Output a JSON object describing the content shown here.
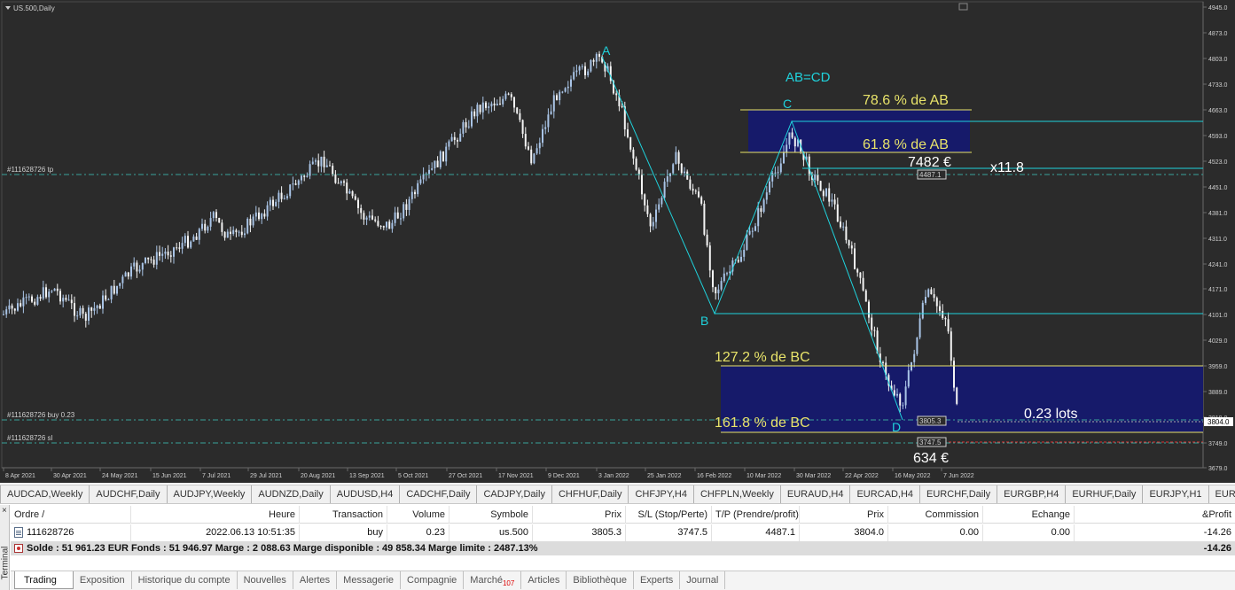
{
  "chart": {
    "symbol_label": "US.500,Daily",
    "colors": {
      "background": "#2b2b2b",
      "bull": "#a9c4e6",
      "bear": "#f4f4f4",
      "zigzag": "#1fd3dd",
      "gold": "#e8e36a",
      "box": "#161a6a",
      "text_white": "#ffffff",
      "price_tag": "#cfcfcf",
      "tp_line": "#3aa39b",
      "sl_line": "#d33"
    },
    "price_axis": [
      "4945.0",
      "4873.0",
      "4803.0",
      "4733.0",
      "4663.0",
      "4593.0",
      "4523.0",
      "4451.0",
      "4381.0",
      "4311.0",
      "4241.0",
      "4171.0",
      "4101.0",
      "4029.0",
      "3959.0",
      "3889.0",
      "3819.0",
      "3804.0",
      "3749.0",
      "3679.0"
    ],
    "time_axis": [
      "8 Apr 2021",
      "30 Apr 2021",
      "24 May 2021",
      "15 Jun 2021",
      "7 Jul 2021",
      "29 Jul 2021",
      "20 Aug 2021",
      "13 Sep 2021",
      "5 Oct 2021",
      "27 Oct 2021",
      "17 Nov 2021",
      "9 Dec 2021",
      "3 Jan 2022",
      "25 Jan 2022",
      "16 Feb 2022",
      "10 Mar 2022",
      "30 Mar 2022",
      "22 Apr 2022",
      "16 May 2022",
      "7 Jun 2022"
    ],
    "points": {
      "a": "A",
      "b": "B",
      "c": "C",
      "d": "D"
    },
    "texts": {
      "ab_cd": "AB=CD",
      "fib_786": "78.6 % de AB",
      "fib_618": "61.8 % de AB",
      "fib_1272": "127.2 % de BC",
      "fib_1618": "161.8 % de BC",
      "tp_money": "7482 €",
      "ratio": "x11.8",
      "lots": "0.23 lots",
      "sl_money": "634 €",
      "tp_label": "#111628726 tp",
      "buy_label": "#111628726 buy 0.23",
      "sl_label": "#111628726 sl",
      "tp_tag": "4487.1",
      "buy_tag": "3805.3",
      "sl_tag": "3747.5",
      "current_price": "3804.0"
    }
  },
  "symbol_tabs": [
    "AUDCAD,Weekly",
    "AUDCHF,Daily",
    "AUDJPY,Weekly",
    "AUDNZD,Daily",
    "AUDUSD,H4",
    "CADCHF,Daily",
    "CADJPY,Daily",
    "CHFHUF,Daily",
    "CHFJPY,H4",
    "CHFPLN,Weekly",
    "EURAUD,H4",
    "EURCAD,H4",
    "EURCHF,Daily",
    "EURGBP,H4",
    "EURHUF,Daily",
    "EURJPY,H1",
    "EURNO"
  ],
  "terminal": {
    "side_label": "Terminal",
    "close_glyph": "×",
    "columns": [
      "Ordre",
      "/",
      "Heure",
      "Transaction",
      "Volume",
      "Symbole",
      "Prix",
      "S/L (Stop/Perte)",
      "T/P (Prendre/profit)",
      "Prix",
      "Commission",
      "Echange",
      "&Profit"
    ],
    "order": {
      "ticket": "111628726",
      "time": "2022.06.13 10:51:35",
      "type": "buy",
      "volume": "0.23",
      "symbol": "us.500",
      "price": "3805.3",
      "sl": "3747.5",
      "tp": "4487.1",
      "current": "3804.0",
      "commission": "0.00",
      "swap": "0.00",
      "profit": "-14.26"
    },
    "summary": "Solde : 51 961.23 EUR  Fonds : 51 946.97  Marge : 2 088.63  Marge disponible : 49 858.34  Marge limite : 2487.13%",
    "summary_profit": "-14.26",
    "tabs": [
      "Trading",
      "Exposition",
      "Historique du compte",
      "Nouvelles",
      "Alertes",
      "Messagerie",
      "Compagnie",
      "Marché",
      "Articles",
      "Bibliothèque",
      "Experts",
      "Journal"
    ],
    "market_badge": "107"
  }
}
